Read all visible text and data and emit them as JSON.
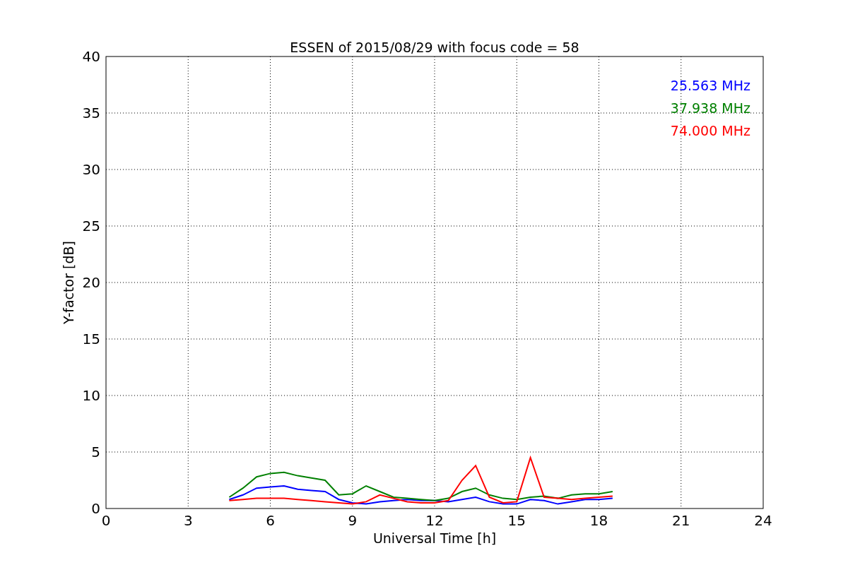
{
  "chart_data": {
    "type": "line",
    "title": "ESSEN of 2015/08/29 with focus code = 58",
    "xlabel": "Universal Time [h]",
    "ylabel": "Y-factor [dB]",
    "x": [
      4.5,
      5,
      5.5,
      6,
      6.5,
      7,
      7.5,
      8,
      8.5,
      9,
      9.5,
      10,
      10.5,
      11,
      11.5,
      12,
      12.5,
      13,
      13.5,
      14,
      14.5,
      15,
      15.5,
      16,
      16.5,
      17,
      17.5,
      18,
      18.5
    ],
    "series": [
      {
        "name": "25.563 MHz",
        "color": "#0000ff",
        "values": [
          0.8,
          1.2,
          1.8,
          1.9,
          2.0,
          1.7,
          1.6,
          1.5,
          0.8,
          0.5,
          0.4,
          0.6,
          0.7,
          0.8,
          0.7,
          0.7,
          0.6,
          0.8,
          1.0,
          0.6,
          0.4,
          0.4,
          0.8,
          0.7,
          0.4,
          0.6,
          0.8,
          0.8,
          0.9
        ]
      },
      {
        "name": "37.938 MHz",
        "color": "#008000",
        "values": [
          1.0,
          1.8,
          2.8,
          3.1,
          3.2,
          2.9,
          2.7,
          2.5,
          1.2,
          1.3,
          2.0,
          1.5,
          1.0,
          0.9,
          0.8,
          0.7,
          0.9,
          1.5,
          1.8,
          1.2,
          0.9,
          0.8,
          1.0,
          1.1,
          0.9,
          1.2,
          1.3,
          1.3,
          1.5
        ]
      },
      {
        "name": "74.000 MHz",
        "color": "#ff0000",
        "values": [
          0.7,
          0.8,
          0.9,
          0.9,
          0.9,
          0.8,
          0.7,
          0.6,
          0.5,
          0.4,
          0.6,
          1.2,
          0.9,
          0.6,
          0.5,
          0.5,
          0.7,
          2.5,
          3.8,
          1.0,
          0.5,
          0.6,
          4.5,
          1.0,
          0.9,
          0.8,
          0.9,
          1.0,
          1.1
        ]
      }
    ],
    "xlim": [
      0,
      24
    ],
    "ylim": [
      0,
      40
    ],
    "xticks": [
      0,
      3,
      6,
      9,
      12,
      15,
      18,
      21,
      24
    ],
    "yticks": [
      0,
      5,
      10,
      15,
      20,
      25,
      30,
      35,
      40
    ],
    "grid": true
  }
}
